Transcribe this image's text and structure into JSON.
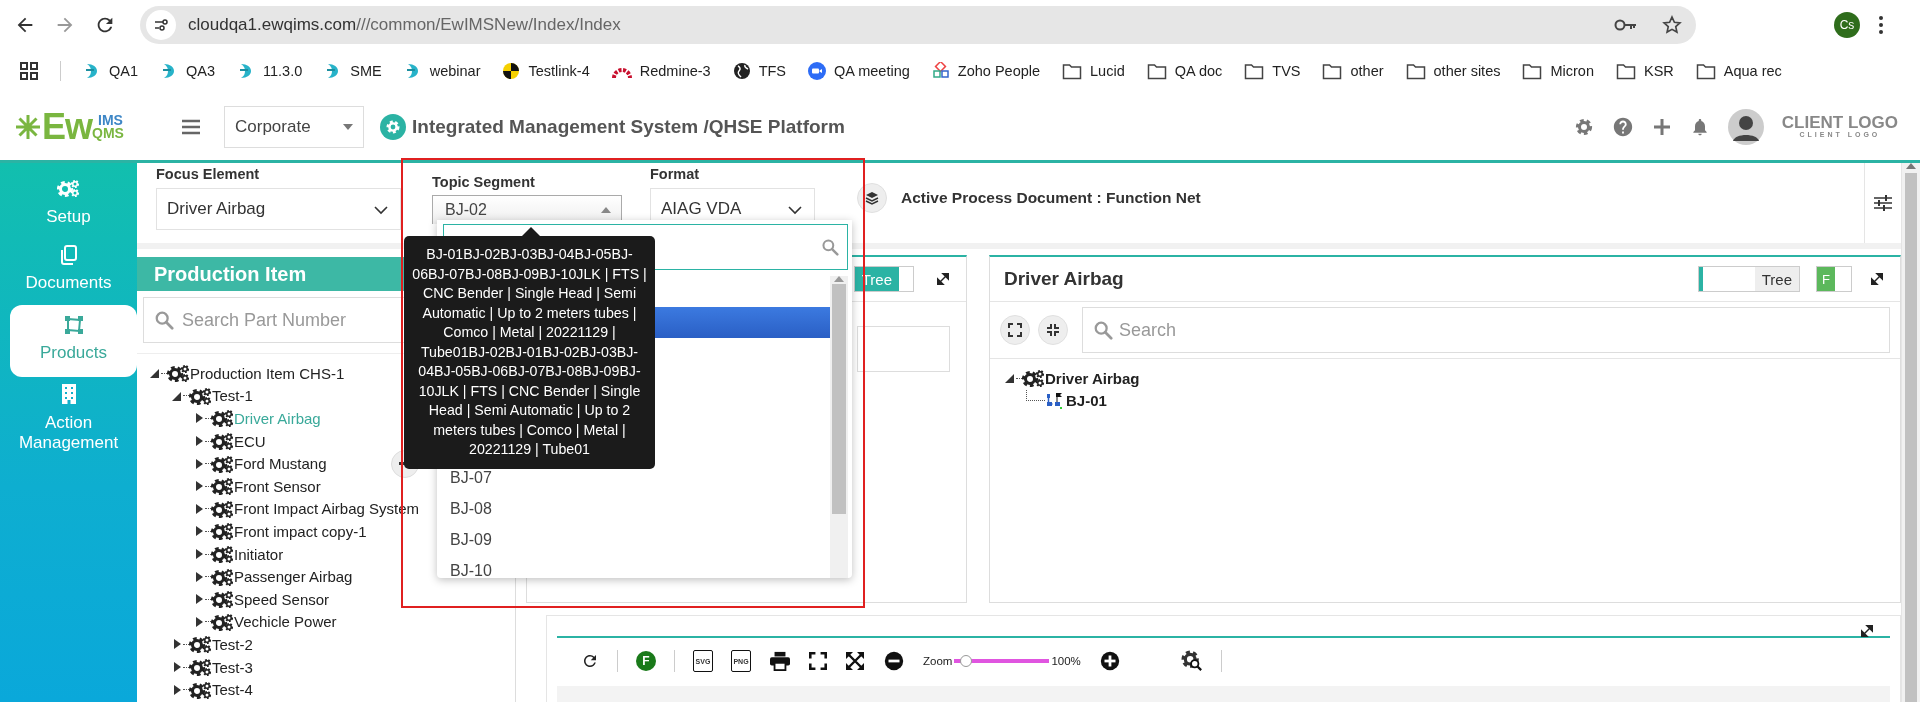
{
  "browser": {
    "url_host": "cloudqa1.ewqims.com",
    "url_path": "///common/EwIMSNew/Index/Index",
    "profile": "Cs"
  },
  "bookmarks": [
    {
      "label": "QA1",
      "kind": "site"
    },
    {
      "label": "QA3",
      "kind": "site"
    },
    {
      "label": "11.3.0",
      "kind": "site"
    },
    {
      "label": "SME",
      "kind": "site"
    },
    {
      "label": "webinar",
      "kind": "site"
    },
    {
      "label": "Testlink-4",
      "kind": "testlink"
    },
    {
      "label": "Redmine-3",
      "kind": "redmine"
    },
    {
      "label": "TFS",
      "kind": "globe"
    },
    {
      "label": "QA meeting",
      "kind": "meeting"
    },
    {
      "label": "Zoho People",
      "kind": "cubes"
    },
    {
      "label": "Lucid",
      "kind": "folder"
    },
    {
      "label": "QA doc",
      "kind": "folder"
    },
    {
      "label": "TVS",
      "kind": "folder"
    },
    {
      "label": "other",
      "kind": "folder"
    },
    {
      "label": "other sites",
      "kind": "folder"
    },
    {
      "label": "Micron",
      "kind": "folder"
    },
    {
      "label": "KSR",
      "kind": "folder"
    },
    {
      "label": "Aqua rec",
      "kind": "folder"
    }
  ],
  "header": {
    "logo_main": "Ew",
    "logo_top": "IMS",
    "logo_bottom": "QMS",
    "org_select": "Corporate",
    "title": "Integrated Management System /QHSE Platform",
    "client_logo": "CLIENT LOGO",
    "client_logo_sub": "CLIENT LOGO"
  },
  "sidebar": [
    {
      "label": "Setup",
      "kind": "setup",
      "selected": false
    },
    {
      "label": "Documents",
      "kind": "documents",
      "selected": false
    },
    {
      "label": "Products",
      "kind": "products",
      "selected": true
    },
    {
      "label": "Action Management",
      "kind": "action",
      "selected": false
    }
  ],
  "filters": {
    "focus_label": "Focus Element",
    "focus_value": "Driver Airbag",
    "topic_label": "Topic Segment",
    "topic_value": "BJ-02",
    "format_label": "Format",
    "format_value": "AIAG VDA",
    "active_document": "Active Process Document : Function Net"
  },
  "production_panel": {
    "title": "Production Item",
    "search_placeholder": "Search Part Number",
    "tree": [
      {
        "label": "Production Item CHS-1",
        "expanded": true,
        "selected": false,
        "children": [
          {
            "label": "Test-1",
            "expanded": true,
            "selected": false,
            "children": [
              {
                "label": "Driver Airbag",
                "expanded": false,
                "selected": true,
                "actions_visible": false
              },
              {
                "label": "ECU",
                "expanded": false,
                "selected": false,
                "actions_visible": false
              },
              {
                "label": "Ford Mustang",
                "expanded": false,
                "selected": false,
                "actions_visible": true
              },
              {
                "label": "Front Sensor",
                "expanded": false,
                "selected": false,
                "actions_visible": false
              },
              {
                "label": "Front Impact Airbag System",
                "expanded": false,
                "selected": false,
                "actions_visible": false
              },
              {
                "label": "Front impact copy-1",
                "expanded": false,
                "selected": false,
                "actions_visible": false
              },
              {
                "label": "Initiator",
                "expanded": false,
                "selected": false,
                "actions_visible": false
              },
              {
                "label": "Passenger Airbag",
                "expanded": false,
                "selected": false,
                "actions_visible": false
              },
              {
                "label": "Speed Sensor",
                "expanded": false,
                "selected": false,
                "actions_visible": false
              },
              {
                "label": "Vechicle Power",
                "expanded": false,
                "selected": false,
                "actions_visible": false
              }
            ]
          },
          {
            "label": "Test-2",
            "expanded": false,
            "selected": false
          },
          {
            "label": "Test-3",
            "expanded": false,
            "selected": false
          },
          {
            "label": "Test-4",
            "expanded": false,
            "selected": false
          }
        ]
      }
    ]
  },
  "middle_panel": {
    "toggle_label": "Tree",
    "toggle_on": true
  },
  "right_panel": {
    "title": "Driver Airbag",
    "toggle_label": "Tree",
    "toggle_on": false,
    "f_toggle": "F",
    "search_placeholder": "Search",
    "tree": [
      {
        "label": "Driver Airbag",
        "expanded": true,
        "children": [
          {
            "label": "BJ-01",
            "kind": "process"
          }
        ]
      }
    ]
  },
  "diagram_toolbar": {
    "f_label": "F",
    "svg_label": "SVG",
    "png_label": "PNG",
    "zoom_label": "Zoom",
    "zoom_reading": "100%",
    "zoom": {
      "level": 0.12
    }
  },
  "topic_dropdown": {
    "covered_rows": [
      {
        "selected": false
      },
      {
        "selected": true
      },
      {
        "selected": false
      },
      {
        "selected": false
      },
      {
        "selected": false
      },
      {
        "selected": false
      }
    ],
    "options": [
      {
        "label": "BJ-07",
        "selected": false
      },
      {
        "label": "BJ-08",
        "selected": false
      },
      {
        "label": "BJ-09",
        "selected": false
      },
      {
        "label": "BJ-10",
        "selected": false
      }
    ],
    "tooltip": "BJ-01BJ-02BJ-03BJ-04BJ-05BJ-06BJ-07BJ-08BJ-09BJ-10JLK | FTS | CNC Bender | Single Head | Semi Automatic | Up to 2 meters tubes | Comco | Metal | 20221129 | Tube01BJ-02BJ-01BJ-02BJ-03BJ-04BJ-05BJ-06BJ-07BJ-08BJ-09BJ-10JLK | FTS | CNC Bender | Single Head | Semi Automatic | Up to 2 meters tubes | Comco | Metal | 20221129 | Tube01"
  }
}
